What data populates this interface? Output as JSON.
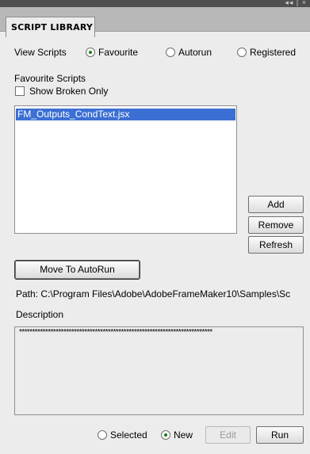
{
  "window": {
    "controls": "◂◂ | ×"
  },
  "tab": {
    "label": "SCRIPT LIBRARY"
  },
  "view_scripts": {
    "label": "View Scripts",
    "options": [
      {
        "label": "Favourite",
        "selected": true
      },
      {
        "label": "Autorun",
        "selected": false
      },
      {
        "label": "Registered",
        "selected": false
      }
    ]
  },
  "favourite": {
    "header": "Favourite Scripts",
    "show_broken_label": "Show Broken Only",
    "show_broken_checked": false,
    "items": [
      {
        "label": "FM_Outputs_CondText.jsx",
        "selected": true
      }
    ]
  },
  "buttons": {
    "add": "Add",
    "remove": "Remove",
    "refresh": "Refresh",
    "move_autorun": "Move To AutoRun",
    "edit": "Edit",
    "run": "Run"
  },
  "path": {
    "text": "Path:  C:\\Program Files\\Adobe\\AdobeFrameMaker10\\Samples\\Sc"
  },
  "description": {
    "label": "Description",
    "text": "**************************************************************************"
  },
  "bottom_options": [
    {
      "label": "Selected",
      "selected": false
    },
    {
      "label": "New",
      "selected": true
    }
  ],
  "colors": {
    "selection": "#3b6fd3",
    "radio_dot": "#1a7a1a",
    "panel_bg": "#ececec"
  }
}
